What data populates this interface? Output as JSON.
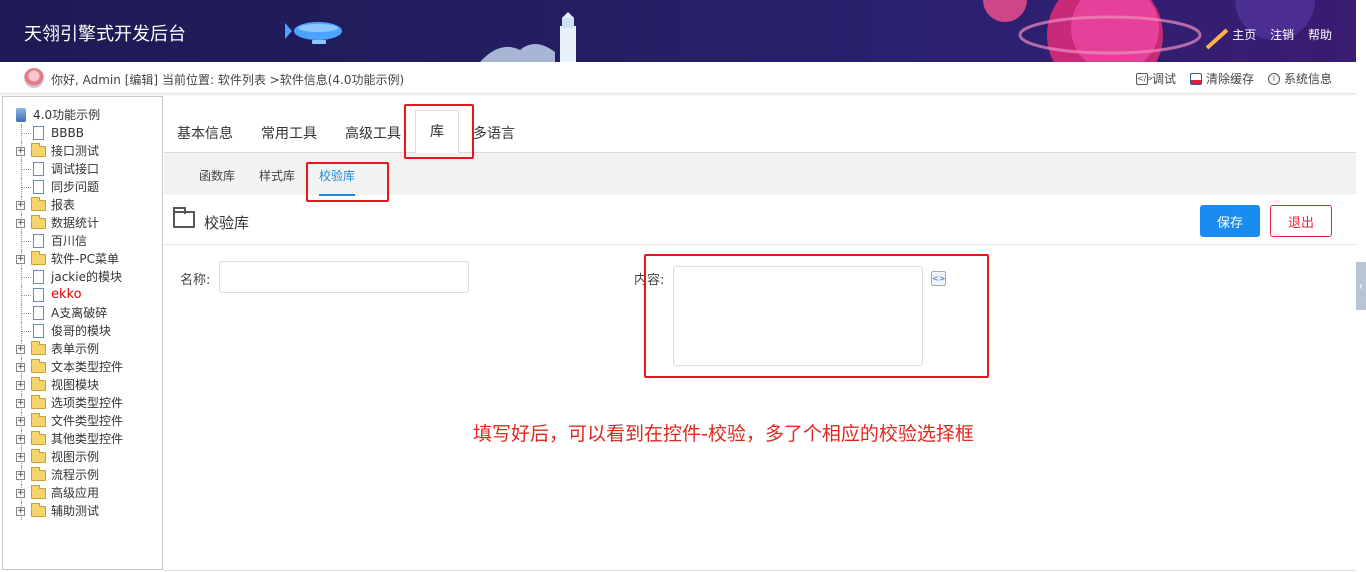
{
  "header": {
    "title": "天翎引擎式开发后台",
    "links": [
      "主页",
      "注销",
      "帮助"
    ]
  },
  "infobar": {
    "greeting": "你好, Admin [编辑]",
    "breadcrumb": "当前位置: 软件列表 >软件信息(4.0功能示例)",
    "tools": [
      {
        "label": "调试",
        "icon": "code-icon"
      },
      {
        "label": "清除缓存",
        "icon": "clear-cache-icon"
      },
      {
        "label": "系统信息",
        "icon": "info-icon"
      }
    ]
  },
  "sidebar": {
    "root": "4.0功能示例",
    "items": [
      {
        "label": "BBBB",
        "type": "doc"
      },
      {
        "label": "接口测试",
        "type": "folder"
      },
      {
        "label": "调试接口",
        "type": "doc"
      },
      {
        "label": "同步问题",
        "type": "doc"
      },
      {
        "label": "报表",
        "type": "folder"
      },
      {
        "label": "数据统计",
        "type": "folder"
      },
      {
        "label": "百川信",
        "type": "doc"
      },
      {
        "label": "软件-PC菜单",
        "type": "folder"
      },
      {
        "label": "jackie的模块",
        "type": "doc"
      },
      {
        "label": "ekko",
        "type": "doc",
        "highlight": "#e00000"
      },
      {
        "label": "A支离破碎",
        "type": "doc"
      },
      {
        "label": "俊哥的模块",
        "type": "doc"
      },
      {
        "label": "表单示例",
        "type": "folder"
      },
      {
        "label": "文本类型控件",
        "type": "folder"
      },
      {
        "label": "视图模块",
        "type": "folder"
      },
      {
        "label": "选项类型控件",
        "type": "folder"
      },
      {
        "label": "文件类型控件",
        "type": "folder"
      },
      {
        "label": "其他类型控件",
        "type": "folder"
      },
      {
        "label": "视图示例",
        "type": "folder"
      },
      {
        "label": "流程示例",
        "type": "folder"
      },
      {
        "label": "高级应用",
        "type": "folder"
      },
      {
        "label": "辅助测试",
        "type": "folder"
      }
    ]
  },
  "tabs": {
    "items": [
      "基本信息",
      "常用工具",
      "高级工具",
      "库",
      "多语言"
    ],
    "active": "库"
  },
  "subtabs": {
    "items": [
      "函数库",
      "样式库",
      "校验库"
    ],
    "active": "校验库"
  },
  "main": {
    "title": "校验库",
    "save_label": "保存",
    "exit_label": "退出",
    "name_label": "名称:",
    "name_value": "",
    "content_label": "内容:",
    "content_value": "",
    "note": "填写好后，可以看到在控件-校验，多了个相应的校验选择框"
  },
  "colors": {
    "accent": "#1a8cf0",
    "annotation": "#e5171a",
    "header_bg": "#1d1a55"
  }
}
